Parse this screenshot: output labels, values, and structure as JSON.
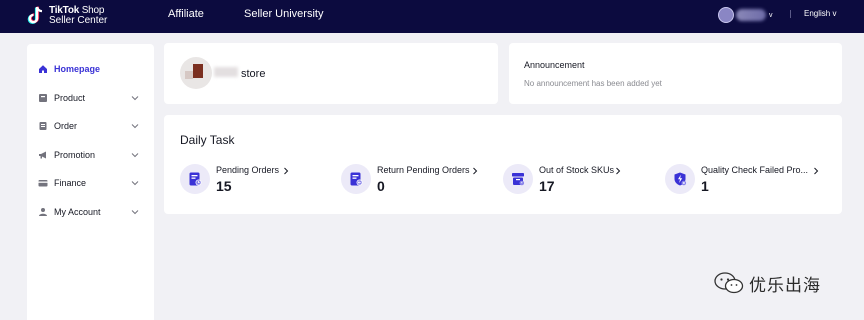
{
  "header": {
    "brand": {
      "line1_bold": "TikTok",
      "line1_thin": " Shop",
      "line2": "Seller Center"
    },
    "nav": [
      {
        "label": "Affiliate"
      },
      {
        "label": "Seller University"
      }
    ],
    "user_caret": "v",
    "language": "English v"
  },
  "sidebar": {
    "items": [
      {
        "label": "Homepage",
        "icon": "home-icon",
        "active": true
      },
      {
        "label": "Product",
        "icon": "product-icon",
        "expandable": true
      },
      {
        "label": "Order",
        "icon": "order-icon",
        "expandable": true
      },
      {
        "label": "Promotion",
        "icon": "megaphone-icon",
        "expandable": true
      },
      {
        "label": "Finance",
        "icon": "card-icon",
        "expandable": true
      },
      {
        "label": "My Account",
        "icon": "user-icon",
        "expandable": true
      }
    ]
  },
  "store": {
    "name": "store"
  },
  "announcement": {
    "title": "Announcement",
    "empty_text": "No announcement has been added yet"
  },
  "daily_task": {
    "title": "Daily Task",
    "tasks": [
      {
        "label": "Pending Orders",
        "count": "15",
        "icon": "pending-orders-icon"
      },
      {
        "label": "Return Pending Orders",
        "count": "0",
        "icon": "return-orders-icon"
      },
      {
        "label": "Out of Stock SKUs",
        "count": "17",
        "icon": "out-of-stock-icon"
      },
      {
        "label": "Quality Check Failed Pro...",
        "count": "1",
        "icon": "quality-check-icon"
      }
    ]
  },
  "watermark": {
    "text": "优乐出海"
  },
  "colors": {
    "header_bg": "#0c0b3f",
    "accent": "#3a32d6",
    "page_bg": "#f1f1f5",
    "icon_bg": "#eceaf8"
  }
}
